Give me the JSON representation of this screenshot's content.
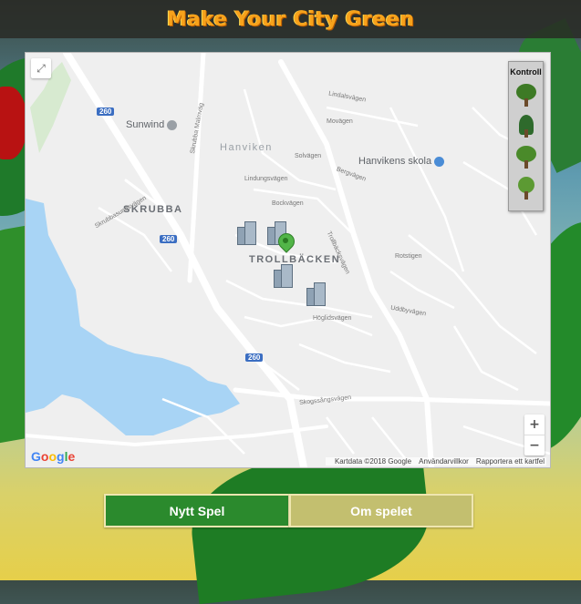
{
  "header": {
    "title": "Make Your City Green"
  },
  "map": {
    "areas": {
      "hanviken": "Hanviken",
      "skrubba": "SKRUBBA",
      "trollbacken": "TROLLBÄCKEN"
    },
    "pois": {
      "sunwind": "Sunwind",
      "school": "Hanvikens skola"
    },
    "road_shields": [
      "260",
      "260",
      "260"
    ],
    "streets": {
      "skrubba_malmvag": "Skrubba Malmväg",
      "trollbackvagen": "Trollbäcksvägen",
      "skogssangsvagen": "Skogssångsvägen",
      "lindalsvagen": "Lindalsvägen",
      "solvagen": "Solvägen",
      "bergvagen": "Bergvägen",
      "bockvagen": "Bockvägen",
      "hoglidsvagen": "Höglidsvägen",
      "uddbyvagen": "Uddbyvägen",
      "rotstigen": "Rotstigen",
      "movagen": "Movägen",
      "lindungsvagen": "Lindungsvägen",
      "skrubbasundsvagen": "Skrubbasundsvägen"
    },
    "attribution": {
      "mapdata": "Kartdata ©2018 Google",
      "terms": "Användarvillkor",
      "report": "Rapportera ett kartfel"
    },
    "google_logo": "Google",
    "zoom_in": "+",
    "zoom_out": "−",
    "fullscreen_icon": "⤢"
  },
  "control": {
    "title": "Kontroll",
    "items": [
      "deciduous-tree-icon",
      "conifer-tree-icon",
      "bush-tree-icon",
      "small-tree-icon"
    ]
  },
  "buttons": {
    "new_game": "Nytt Spel",
    "about": "Om spelet"
  },
  "colors": {
    "title": "#f7a21b",
    "new_game_bg": "#2b8a2d",
    "about_bg": "#c3bf6f",
    "water": "#a8d4f5"
  }
}
